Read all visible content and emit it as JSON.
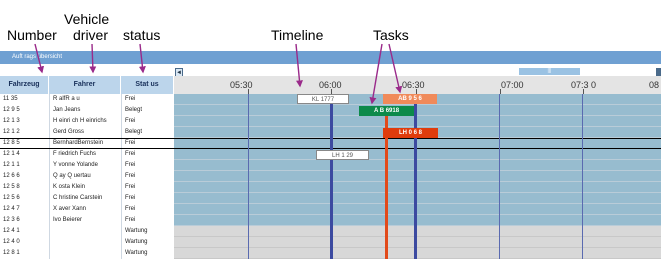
{
  "annotations": {
    "number": "Number",
    "vehicle": "Vehicle",
    "driver": "driver",
    "status": "status",
    "timeline": "Timeline",
    "tasks": "Tasks"
  },
  "window": {
    "title": "Auft rags übersicht",
    "scroll_left_glyph": "◄",
    "scroll_thumb_label": "|||"
  },
  "columns": {
    "number": "Fahrzeug",
    "driver": "Fahrer",
    "status": "Stat us"
  },
  "timeline": {
    "labels": [
      "05:30",
      "06:00",
      "06:30",
      "07:00",
      "07:3 0",
      "08"
    ]
  },
  "rows": [
    {
      "number": "11 35",
      "driver": "R alfR a u",
      "status": "Frei",
      "lane": "free"
    },
    {
      "number": "12 9 5",
      "driver": "Jan Jeans",
      "status": "Belegt",
      "lane": "free"
    },
    {
      "number": "12 1 3",
      "driver": "H einri ch H einrichs",
      "status": "Frei",
      "lane": "free"
    },
    {
      "number": "12 1 2",
      "driver": "Gerd Gross",
      "status": "Belegt",
      "lane": "free"
    },
    {
      "number": "12 8 5",
      "driver": "BernhardBernstein",
      "status": "Frei",
      "lane": "free"
    },
    {
      "number": "12 1 4",
      "driver": "F riedrich Fuchs",
      "status": "Frei",
      "lane": "free"
    },
    {
      "number": "12 1 1",
      "driver": "Y vonne Yolande",
      "status": "Frei",
      "lane": "free"
    },
    {
      "number": "12 6 6",
      "driver": "Q ay Q uertau",
      "status": "Frei",
      "lane": "free"
    },
    {
      "number": "12 5 8",
      "driver": "K osta Klein",
      "status": "Frei",
      "lane": "free"
    },
    {
      "number": "12 5 6",
      "driver": "C hristine Carstein",
      "status": "Frei",
      "lane": "free"
    },
    {
      "number": "12 4 7",
      "driver": "X aver Xann",
      "status": "Frei",
      "lane": "free"
    },
    {
      "number": "12 3 6",
      "driver": "Ivo Beierer",
      "status": "Frei",
      "lane": "free"
    },
    {
      "number": "12 4 1",
      "driver": "",
      "status": "Wartung",
      "lane": "maint"
    },
    {
      "number": "12 4 0",
      "driver": "",
      "status": "Wartung",
      "lane": "maint"
    },
    {
      "number": "12 8 1",
      "driver": "",
      "status": "Wartung",
      "lane": "maint"
    }
  ],
  "tasks": [
    {
      "label": "KL 1777",
      "style": "white"
    },
    {
      "label": "AB 9 5 6",
      "style": "orange"
    },
    {
      "label": "A B 6918",
      "style": "green"
    },
    {
      "label": "LH 0 6 8",
      "style": "red"
    },
    {
      "label": "LH 1 29",
      "style": "white"
    }
  ]
}
